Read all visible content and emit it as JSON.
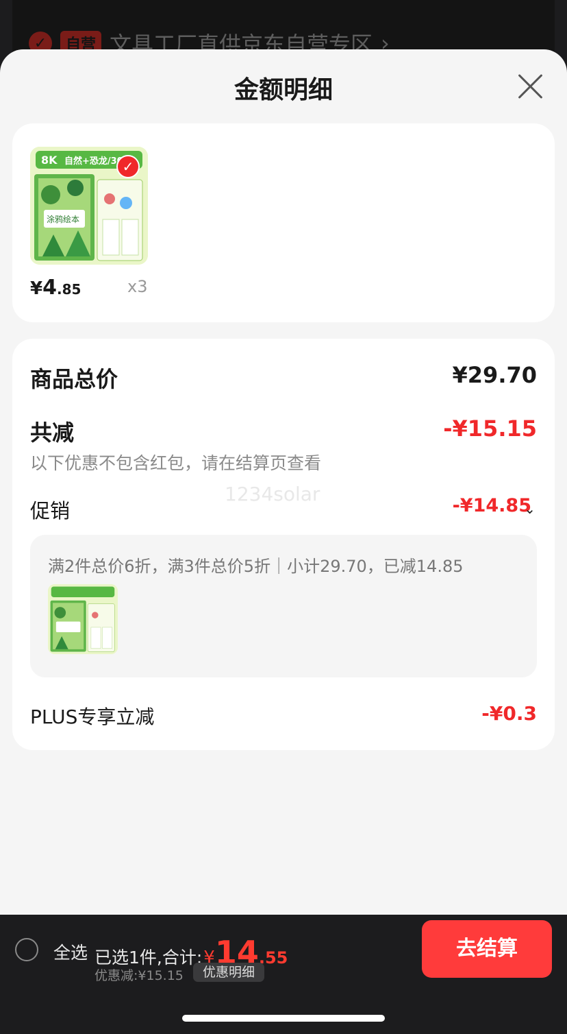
{
  "background": {
    "badge": "自营",
    "store_text": "文具工厂直供京东自营专区"
  },
  "sheet": {
    "title": "金额明细"
  },
  "product": {
    "image_tag": "8K",
    "image_title": "自然+恐龙/30张",
    "image_caption": "涂鸦绘本",
    "price_symbol": "¥",
    "price_int": "4",
    "price_dec": ".85",
    "qty": "x3",
    "selected": true
  },
  "detail": {
    "total_label": "商品总价",
    "total_value": "¥29.70",
    "reduce_label": "共减",
    "reduce_value": "-¥15.15",
    "note": "以下优惠不包含红包，请在结算页查看",
    "promo_label": "促销",
    "promo_value": "-¥14.85",
    "promo_rule": "满2件总价6折，满3件总价5折｜小计29.70，已减14.85",
    "plus_label": "PLUS专享立减",
    "plus_value": "-¥0.3",
    "watermark": "1234solar"
  },
  "bottom": {
    "select_all": "全选",
    "summary_prefix": "已选1件,合计:",
    "total_symbol": "¥",
    "total_int": "14",
    "total_dec": ".55",
    "discount": "优惠减:¥15.15",
    "discount_detail": "优惠明细",
    "checkout": "去结算"
  },
  "colors": {
    "accent_red": "#f0282a",
    "checkout_red": "#ff3b3b",
    "sheet_bg": "#f5f5f5"
  }
}
